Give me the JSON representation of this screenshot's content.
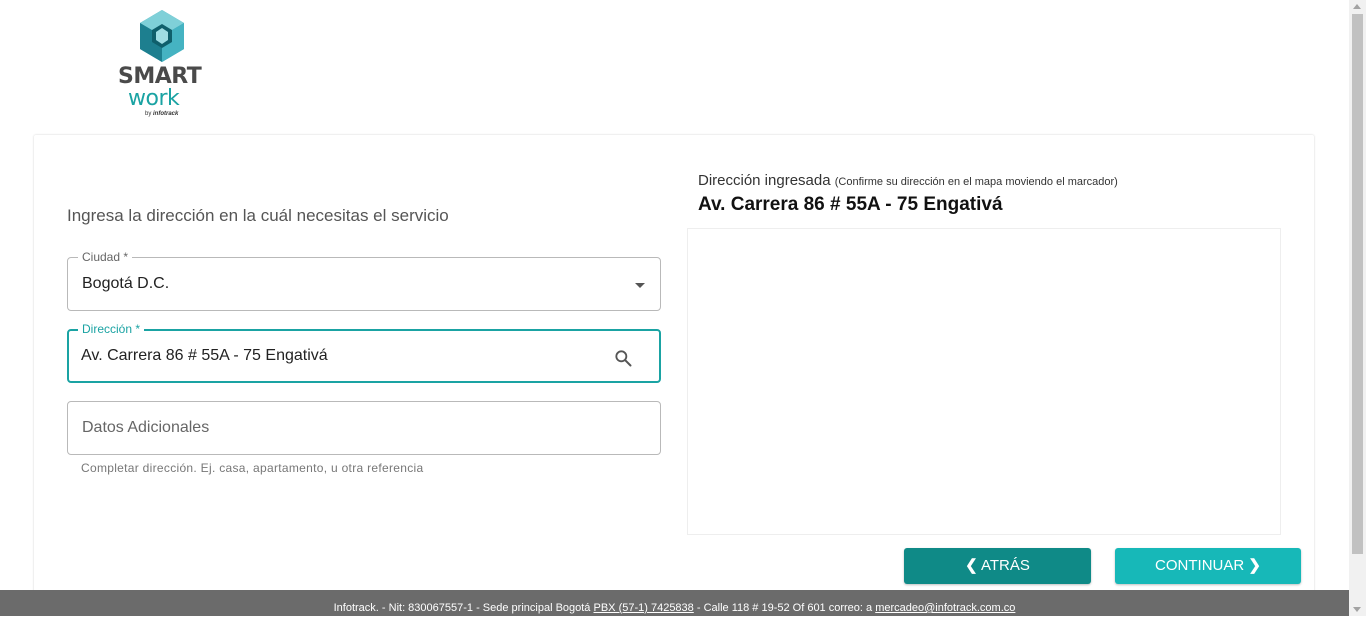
{
  "brand": {
    "name_top": "SMART",
    "name_bottom": "work",
    "by_prefix": "by",
    "by_company": "infotrack"
  },
  "form": {
    "prompt": "Ingresa la dirección en la cuál necesitas el servicio",
    "ciudad": {
      "label": "Ciudad *",
      "value": "Bogotá D.C."
    },
    "direccion": {
      "label": "Dirección *",
      "value": "Av. Carrera 86 # 55A - 75 Engativá"
    },
    "datos": {
      "placeholder": "Datos Adicionales",
      "helper": "Completar dirección. Ej. casa, apartamento, u otra referencia"
    }
  },
  "address_panel": {
    "label": "Dirección ingresada",
    "hint": "(Confirme su dirección en el mapa moviendo el marcador)",
    "value": "Av. Carrera 86 # 55A - 75 Engativá"
  },
  "buttons": {
    "back": "ATRÁS",
    "continue": "CONTINUAR"
  },
  "footer": {
    "text_1": "Infotrack. - Nit: 830067557-1 - Sede principal Bogotá",
    "pbx": "PBX (57-1) 7425838",
    "text_2": "- Calle 118 # 19-52 Of 601   correo: a",
    "email": "mercadeo@infotrack.com.co"
  },
  "colors": {
    "accent": "#1aa3a3",
    "back_button": "#0f8a87",
    "continue_button": "#17b8b8",
    "footer_bg": "#6b6b6b"
  }
}
